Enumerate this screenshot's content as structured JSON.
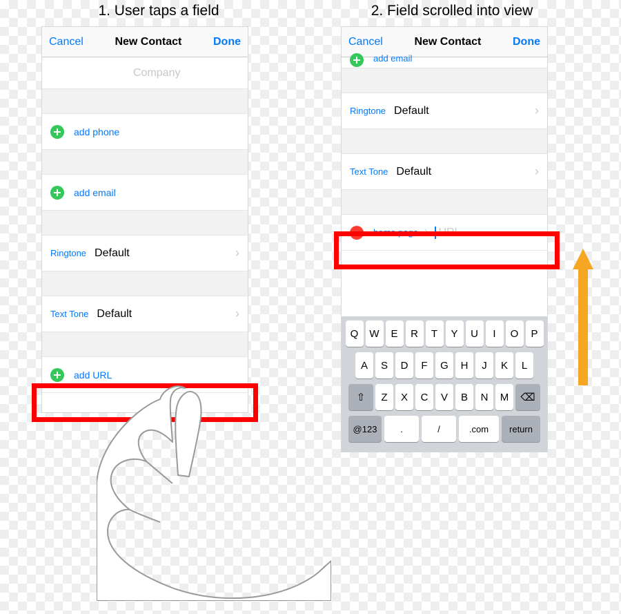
{
  "captions": {
    "left": "1. User taps a field",
    "right": "2. Field scrolled into view"
  },
  "nav": {
    "cancel": "Cancel",
    "title": "New Contact",
    "done": "Done"
  },
  "left_screen": {
    "company_placeholder": "Company",
    "add_phone": "add phone",
    "add_email": "add email",
    "ringtone_label": "Ringtone",
    "ringtone_value": "Default",
    "texttone_label": "Text Tone",
    "texttone_value": "Default",
    "add_url": "add URL"
  },
  "right_screen": {
    "add_email": "add email",
    "ringtone_label": "Ringtone",
    "ringtone_value": "Default",
    "texttone_label": "Text Tone",
    "texttone_value": "Default",
    "homepage_label": "home page",
    "url_placeholder": "URL"
  },
  "keyboard": {
    "row1": [
      "Q",
      "W",
      "E",
      "R",
      "T",
      "Y",
      "U",
      "I",
      "O",
      "P"
    ],
    "row2": [
      "A",
      "S",
      "D",
      "F",
      "G",
      "H",
      "J",
      "K",
      "L"
    ],
    "row3": [
      "Z",
      "X",
      "C",
      "V",
      "B",
      "N",
      "M"
    ],
    "shift": "⇧",
    "backspace": "⌫",
    "numbers": "@123",
    "period": ".",
    "slash": "/",
    "dotcom": ".com",
    "return": "return"
  }
}
